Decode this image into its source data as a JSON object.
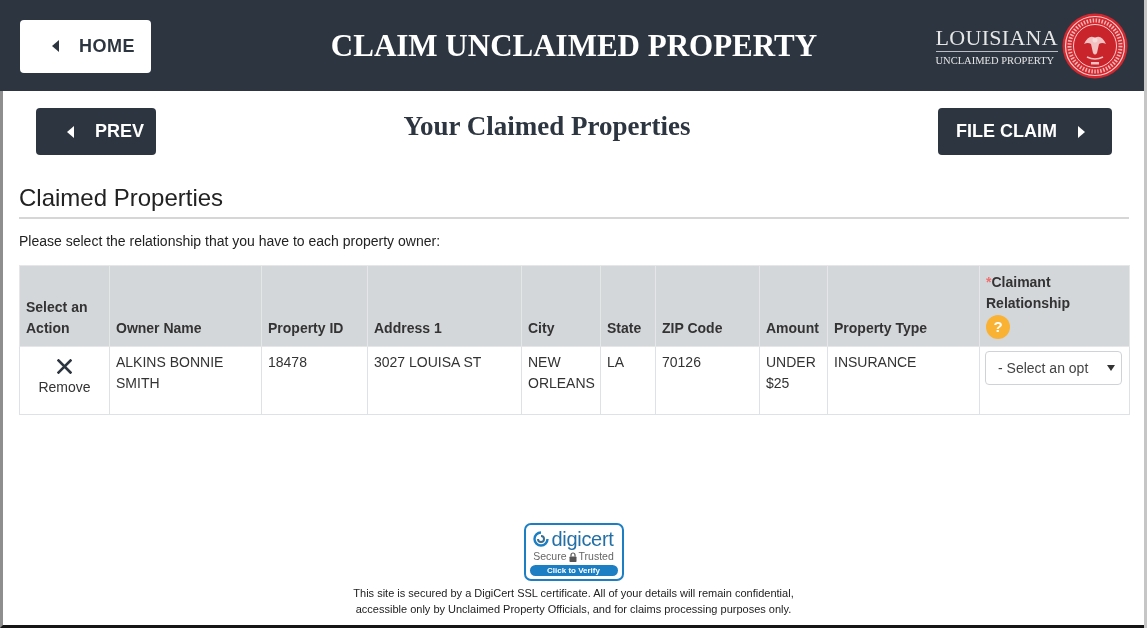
{
  "header": {
    "home_button": "HOME",
    "title": "CLAIM UNCLAIMED PROPERTY",
    "logo": {
      "name": "LOUISIANA",
      "tagline": "UNCLAIMED PROPERTY"
    }
  },
  "nav": {
    "prev_button": "PREV",
    "title": "Your Claimed Properties",
    "next_button": "FILE CLAIM"
  },
  "section": {
    "heading": "Claimed Properties",
    "instruction": "Please select the relationship that you have to each property owner:"
  },
  "table": {
    "columns": [
      {
        "label": "Select an Action"
      },
      {
        "label": "Owner Name"
      },
      {
        "label": "Property ID"
      },
      {
        "label": "Address 1"
      },
      {
        "label": "City"
      },
      {
        "label": "State"
      },
      {
        "label": "ZIP Code"
      },
      {
        "label": "Amount"
      },
      {
        "label": "Property Type"
      },
      {
        "label": "Claimant Relationship",
        "required_mark": "*",
        "help": "?"
      }
    ],
    "rows": [
      {
        "action": "Remove",
        "owner_name": "ALKINS BONNIE SMITH",
        "property_id": "18478",
        "address_1": "3027 LOUISA ST",
        "city": "NEW ORLEANS",
        "state": "LA",
        "zip_code": "70126",
        "amount": "UNDER $25",
        "property_type": "INSURANCE",
        "relationship": {
          "value": "- Select an opt"
        }
      }
    ]
  },
  "footer": {
    "badge": {
      "brand": "digicert",
      "left_word": "Secure",
      "right_word": "Trusted",
      "verify": "Click to Verify"
    },
    "notice": "This site is secured by a DigiCert SSL certificate. All of your details will remain confidential, accessible only by Unclaimed Property Officials, and for claims processing purposes only."
  }
}
